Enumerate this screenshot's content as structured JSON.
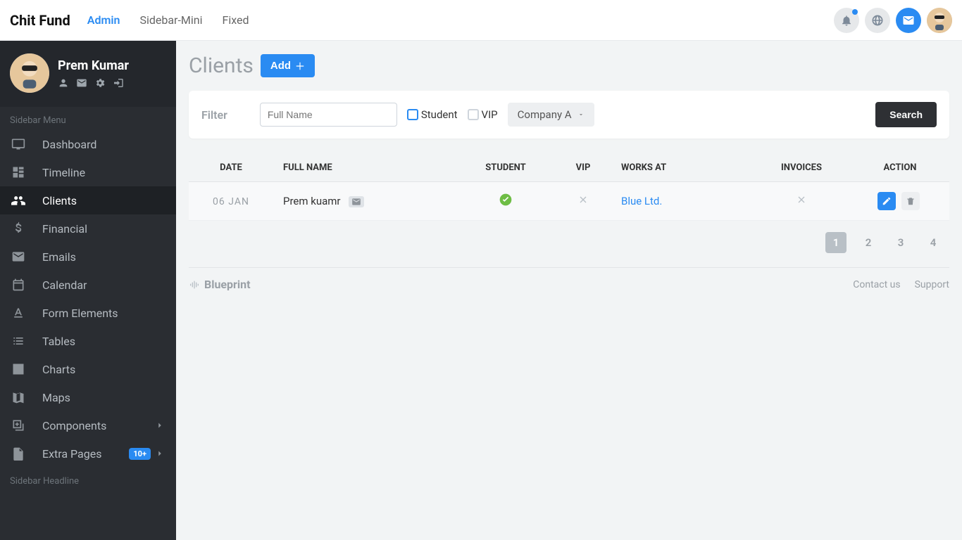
{
  "navbar": {
    "brand": "Chit Fund",
    "links": [
      "Admin",
      "Sidebar-Mini",
      "Fixed"
    ],
    "active_index": 0
  },
  "user": {
    "name": "Prem Kumar"
  },
  "sidebar": {
    "heading1": "Sidebar Menu",
    "heading2": "Sidebar Headline",
    "items": [
      {
        "icon": "tv",
        "label": "Dashboard"
      },
      {
        "icon": "grid",
        "label": "Timeline"
      },
      {
        "icon": "people",
        "label": "Clients",
        "active": true
      },
      {
        "icon": "dollar",
        "label": "Financial"
      },
      {
        "icon": "mail",
        "label": "Emails"
      },
      {
        "icon": "calendar",
        "label": "Calendar"
      },
      {
        "icon": "textformat",
        "label": "Form Elements"
      },
      {
        "icon": "list",
        "label": "Tables"
      },
      {
        "icon": "bar",
        "label": "Charts"
      },
      {
        "icon": "map",
        "label": "Maps"
      },
      {
        "icon": "plusbox",
        "label": "Components",
        "chevron": true
      },
      {
        "icon": "doc",
        "label": "Extra Pages",
        "badge": "10+",
        "chevron": true
      }
    ]
  },
  "page": {
    "title": "Clients",
    "add_label": "Add"
  },
  "filter": {
    "label": "Filter",
    "name_placeholder": "Full Name",
    "student_label": "Student",
    "vip_label": "VIP",
    "company_selected": "Company A",
    "search_label": "Search"
  },
  "table": {
    "headers": {
      "date": "DATE",
      "full_name": "FULL NAME",
      "student": "STUDENT",
      "vip": "VIP",
      "works_at": "WORKS AT",
      "invoices": "INVOICES",
      "action": "ACTION"
    },
    "row": {
      "date": "06 JAN",
      "full_name": "Prem kuamr",
      "student": true,
      "vip": false,
      "works_at": "Blue Ltd.",
      "invoices": false
    }
  },
  "pager": {
    "current": "1",
    "pages": [
      "1",
      "2",
      "3",
      "4"
    ]
  },
  "footer": {
    "brand": "Blueprint",
    "contact": "Contact us",
    "support": "Support"
  }
}
